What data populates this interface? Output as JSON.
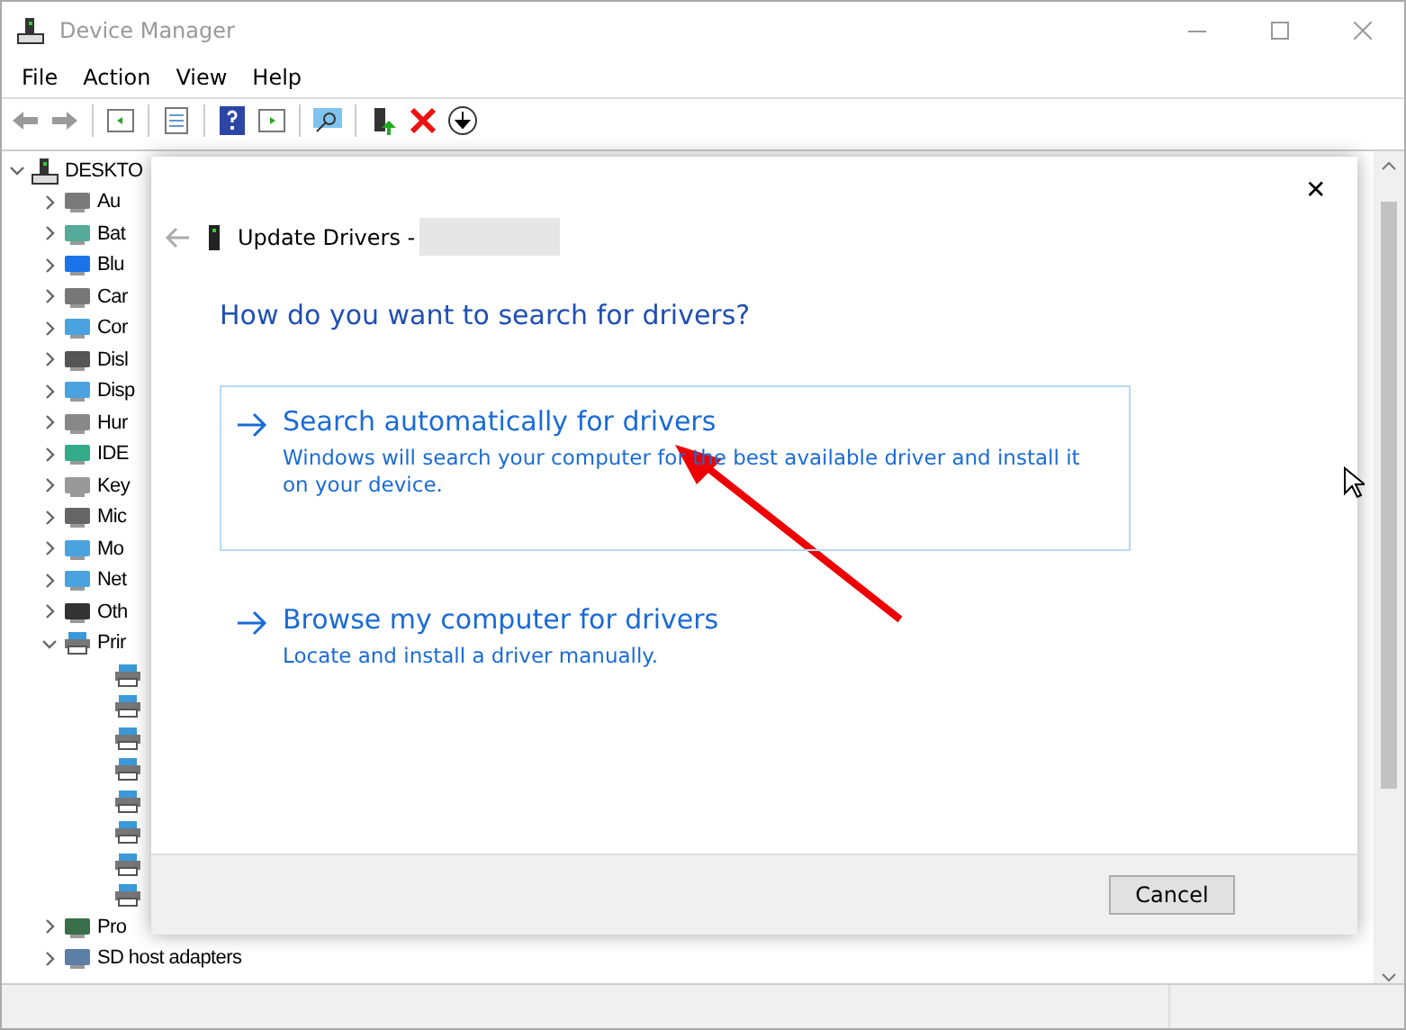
{
  "window": {
    "title": "Device Manager"
  },
  "menu": [
    "File",
    "Action",
    "View",
    "Help"
  ],
  "tree": {
    "root": {
      "label": "DESKTO",
      "expanded": true
    },
    "items": [
      {
        "label": "Au",
        "expanded": false
      },
      {
        "label": "Bat",
        "expanded": false
      },
      {
        "label": "Blu",
        "expanded": false
      },
      {
        "label": "Car",
        "expanded": false
      },
      {
        "label": "Cor",
        "expanded": false
      },
      {
        "label": "Disl",
        "expanded": false
      },
      {
        "label": "Disp",
        "expanded": false
      },
      {
        "label": "Hur",
        "expanded": false
      },
      {
        "label": "IDE",
        "expanded": false
      },
      {
        "label": "Key",
        "expanded": false
      },
      {
        "label": "Mic",
        "expanded": false
      },
      {
        "label": "Mo",
        "expanded": false
      },
      {
        "label": "Net",
        "expanded": false
      },
      {
        "label": "Oth",
        "expanded": false
      },
      {
        "label": "Prir",
        "expanded": true,
        "children": [
          {
            "kind": "printer"
          },
          {
            "kind": "printer"
          },
          {
            "kind": "printer"
          },
          {
            "kind": "printer"
          },
          {
            "kind": "printer"
          },
          {
            "kind": "printer"
          },
          {
            "kind": "printer"
          },
          {
            "kind": "printer"
          }
        ]
      },
      {
        "label": "Pro",
        "expanded": false
      },
      {
        "label": "SD host adapters",
        "expanded": false
      }
    ]
  },
  "dialog": {
    "title": "Update Drivers -",
    "heading": "How do you want to search for drivers?",
    "options": [
      {
        "title": "Search automatically for drivers",
        "description": "Windows will search your computer for the best available driver and install it on your device.",
        "selected": true
      },
      {
        "title": "Browse my computer for drivers",
        "description": "Locate and install a driver manually.",
        "selected": false
      }
    ],
    "button": "Cancel",
    "close": "✕"
  }
}
